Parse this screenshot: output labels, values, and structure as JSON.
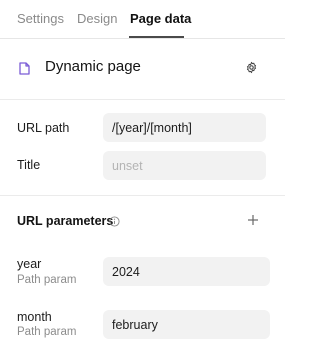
{
  "tabs": [
    {
      "label": "Settings",
      "active": false
    },
    {
      "label": "Design",
      "active": false
    },
    {
      "label": "Page data",
      "active": true
    }
  ],
  "page": {
    "icon": "page-icon",
    "title": "Dynamic page",
    "settings_icon": "gear-icon"
  },
  "fields": {
    "url_path": {
      "label": "URL path",
      "value": "/[year]/[month]"
    },
    "title": {
      "label": "Title",
      "placeholder": "unset"
    }
  },
  "url_parameters": {
    "title": "URL parameters",
    "info_icon": "info-icon",
    "add_icon": "plus-icon",
    "items": [
      {
        "name": "year",
        "type": "Path param",
        "value": "2024"
      },
      {
        "name": "month",
        "type": "Path param",
        "value": "february"
      }
    ]
  }
}
